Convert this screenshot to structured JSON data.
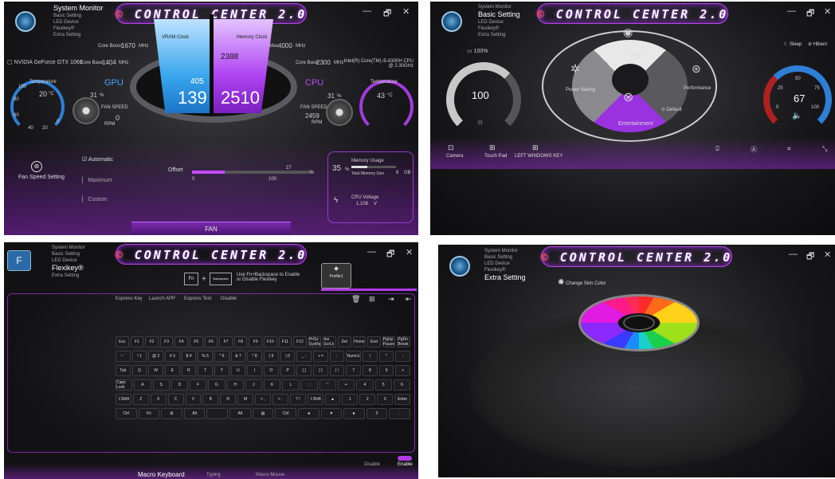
{
  "app_title": "CONTROL CENTER 2.0",
  "window_controls": [
    "—",
    "🗗",
    "✕"
  ],
  "panel1": {
    "menu_current": "System Monitor",
    "menu_items": [
      "Basic Setting",
      "LED Device",
      "Flexikey®",
      "Extra Setting"
    ],
    "gpu_name": "NVIDIA GeForce GTX 1060",
    "cpu_name": "Intel(R) Core(TM) i5-8300H CPU @ 2.30GHz",
    "core_boost_label": "Core Boost",
    "core_boost": "1670",
    "core_base_label": "Core Base",
    "core_base_gpu": "1404",
    "mhz": "MHz",
    "turbo_max_label": "Turbo Max",
    "turbo_max": "4000",
    "core_base_cpu": "2300",
    "vram_clock_label": "VRAM Clock",
    "memory_clock_label": "Memory Clock",
    "memory_clock": "2388",
    "vram_small": "405",
    "gpu_big": "139",
    "cpu_big": "2510",
    "gpu_label": "GPU",
    "cpu_label": "CPU",
    "temp_label": "Temperature",
    "gpu_temp": "20",
    "gpu_temp_unit": "°C",
    "gpu_fan_pct": "31",
    "pct": "%",
    "fan_speed_label": "FAN SPEED",
    "gpu_rpm": "0",
    "rpm": "RPM",
    "cpu_temp": "43",
    "cpu_fan_pct": "31",
    "cpu_rpm": "2459",
    "fan_speed_setting": "Fan Speed Setting",
    "fan_modes": [
      "Automatic",
      "Maximum",
      "Custom"
    ],
    "offset_label": "Offset",
    "offset_value": "27",
    "slider_min": "0",
    "slider_max": "100",
    "memory_usage_label": "Memory Usage",
    "memory_pct": "35",
    "total_memory_label": "Total Memory Size",
    "total_memory": "8",
    "gb": "GB",
    "cpu_voltage_label": "CPU Voltage",
    "cpu_voltage": "1.108",
    "volt": "V",
    "fan_tab": "FAN",
    "gauge_ticks": [
      "100",
      "80",
      "60",
      "40",
      "20",
      "0"
    ]
  },
  "panel2": {
    "menu_current": "Basic Setting",
    "menu_items_top": [
      "System Monitor"
    ],
    "menu_items": [
      "LED Device",
      "Flexikey®",
      "Extra Setting"
    ],
    "battery": "100%",
    "brightness": "100",
    "volume": "67",
    "modes": [
      "Quiet",
      "Power Saving",
      "Performance",
      "Entertainment"
    ],
    "default_label": "Default",
    "sleep_label": "Sleep",
    "hibernate_label": "Hibern",
    "toggles": [
      "Camera",
      "Touch Pad",
      "LEFT WINDOWS KEY"
    ],
    "volume_ticks": [
      "50",
      "25",
      "75",
      "0",
      "100"
    ]
  },
  "panel3": {
    "menu_current": "Flexikey®",
    "menu_items_top": [
      "System Monitor",
      "Basic Setting",
      "LED Device"
    ],
    "menu_items": [
      "Extra Setting"
    ],
    "hint_fn": "Fn",
    "hint_backspace": "Backspace",
    "hint_text": "Use Fn+Backspace to Enable or Disable Flexikey",
    "profile_label": "Profile1",
    "tabs": [
      "Express Key",
      "Launch APP",
      "Express Text",
      "Disable"
    ],
    "keyboard_rows": [
      [
        "Esc",
        "F1",
        "F2",
        "F3",
        "F4",
        "F5",
        "F6",
        "F7",
        "F8",
        "F9",
        "F10",
        "F11",
        "F12",
        "PrtSc SysRq",
        "Ins ScrLk",
        "Del",
        "Home",
        "End",
        "PgUp Pause",
        "PgDn Break"
      ],
      [
        "~ `",
        "! 1",
        "@ 2",
        "# 3",
        "$ 4",
        "% 5",
        "^ 6",
        "& 7",
        "* 8",
        "( 9",
        ") 0",
        "_ -",
        "+ =",
        "←",
        "NumLk",
        "/",
        "*",
        "-"
      ],
      [
        "Tab",
        "Q",
        "W",
        "E",
        "R",
        "T",
        "Y",
        "U",
        "I",
        "O",
        "P",
        "{ [",
        "} ]",
        "| \\",
        "7",
        "8",
        "9",
        "+"
      ],
      [
        "Caps Lock",
        "A",
        "S",
        "D",
        "F",
        "G",
        "H",
        "J",
        "K",
        "L",
        ": ;",
        "\" '",
        "↵",
        "4",
        "5",
        "6"
      ],
      [
        "⇧Shift",
        "Z",
        "X",
        "C",
        "V",
        "B",
        "N",
        "M",
        "< ,",
        "> .",
        "? /",
        "⇧Shift",
        "▲",
        "1",
        "2",
        "3",
        "Enter"
      ],
      [
        "Ctrl",
        "Fn",
        "⊞",
        "Alt",
        "",
        "Alt",
        "▤",
        "Ctrl",
        "◄",
        "▼",
        "►",
        "0",
        "."
      ]
    ],
    "disable_label": "Disable",
    "enable_label": "Enable",
    "bottom_tabs": [
      "Macro Keyboard",
      "Typing",
      "Macro Mouse"
    ]
  },
  "panel4": {
    "menu_current": "Extra Setting",
    "menu_items_top": [
      "System Monitor",
      "Basic Setting",
      "LED Device",
      "Flexikey®"
    ],
    "skin_label": "Change Skin Color",
    "wheel_colors": [
      "#ff2a2a",
      "#ff6a1a",
      "#ffd21a",
      "#9ee01a",
      "#1ad04a",
      "#1ad0c8",
      "#1a8cff",
      "#3a3aff",
      "#8a2aff",
      "#e01ae0",
      "#ff1a8c",
      "#ff2a5a"
    ]
  },
  "accent": "#a43ae0"
}
